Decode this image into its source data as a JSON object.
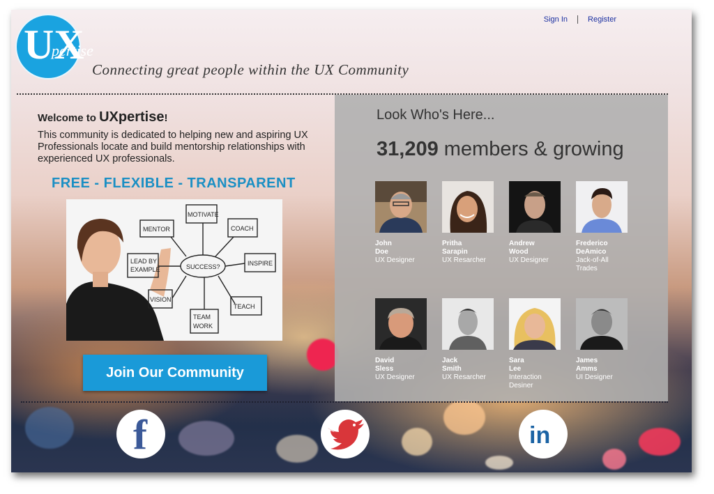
{
  "header": {
    "logo_letters": "UX",
    "logo_suffix": "pertise",
    "tagline": "Connecting great people within the UX Community",
    "sign_in": "Sign In",
    "register": "Register"
  },
  "welcome": {
    "prefix": "Welcome to ",
    "brand": "UXpertise",
    "suffix": "!",
    "body": "This community is dedicated to helping new and aspiring UX Professionals locate and build mentorship relationships with experienced UX professionals.",
    "values": "FREE - FLEXIBLE - TRANSPARENT"
  },
  "hero": {
    "center": "SUCCESS?",
    "nodes": [
      "MOTIVATE",
      "MENTOR",
      "COACH",
      "LEAD BY",
      "EXAMPLE",
      "INSPIRE",
      "VISION",
      "TEAM",
      "WORK",
      "TEACH"
    ]
  },
  "cta": {
    "join_label": "Join Our Community"
  },
  "members_panel": {
    "title": "Look Who's Here...",
    "count": "31,209",
    "count_suffix": " members & growing",
    "members": [
      {
        "first": "John",
        "last": "Doe",
        "role_1": "UX Designer",
        "role_2": ""
      },
      {
        "first": "Pritha",
        "last": "Sarapin",
        "role_1": "UX Resarcher",
        "role_2": ""
      },
      {
        "first": "Andrew",
        "last": "Wood",
        "role_1": "UX Designer",
        "role_2": ""
      },
      {
        "first": "Frederico",
        "last": "DeAmico",
        "role_1": "Jack-of-All",
        "role_2": "Trades"
      },
      {
        "first": "David",
        "last": "Sless",
        "role_1": "UX Designer",
        "role_2": ""
      },
      {
        "first": "Jack",
        "last": "Smith",
        "role_1": "UX Resarcher",
        "role_2": ""
      },
      {
        "first": "Sara",
        "last": "Lee",
        "role_1": "Interaction",
        "role_2": "Desiner"
      },
      {
        "first": "James",
        "last": "Amms",
        "role_1": "UI Designer",
        "role_2": ""
      }
    ]
  },
  "social": {
    "facebook_glyph": "f",
    "linkedin_glyph": "in",
    "icons": [
      "facebook-icon",
      "twitter-icon",
      "linkedin-icon"
    ]
  },
  "colors": {
    "brand_blue": "#1a9ad8",
    "values_blue": "#1a8fc4",
    "facebook": "#3b5998",
    "twitter": "#d9363a",
    "linkedin": "#1b63a4"
  }
}
